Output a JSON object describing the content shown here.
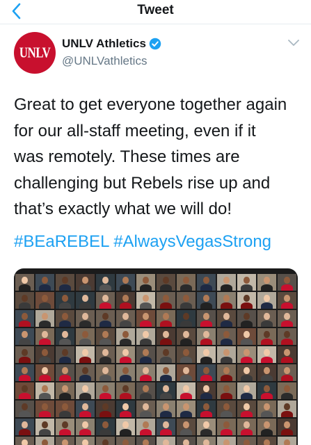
{
  "header": {
    "title": "Tweet",
    "back_icon": "chevron-left-icon"
  },
  "author": {
    "avatar_text": "UNLV",
    "name": "UNLV Athletics",
    "handle": "@UNLVathletics",
    "verified_icon": "verified-badge-icon",
    "menu_icon": "chevron-down-icon"
  },
  "tweet": {
    "lines": [
      "Great to get everyone together again",
      "for our all-staff meeting, even if it",
      "was remotely. These times are",
      "challenging but Rebels rise up and",
      "that’s exactly what we will do!"
    ],
    "hashtags": [
      "#BEaREBEL",
      "#AlwaysVegasStrong"
    ]
  },
  "media": {
    "description_icon": "video-call-grid-image"
  },
  "colors": {
    "accent": "#1da1f2",
    "brand_red": "#c8102e",
    "text": "#14171a",
    "secondary_text": "#657786"
  }
}
